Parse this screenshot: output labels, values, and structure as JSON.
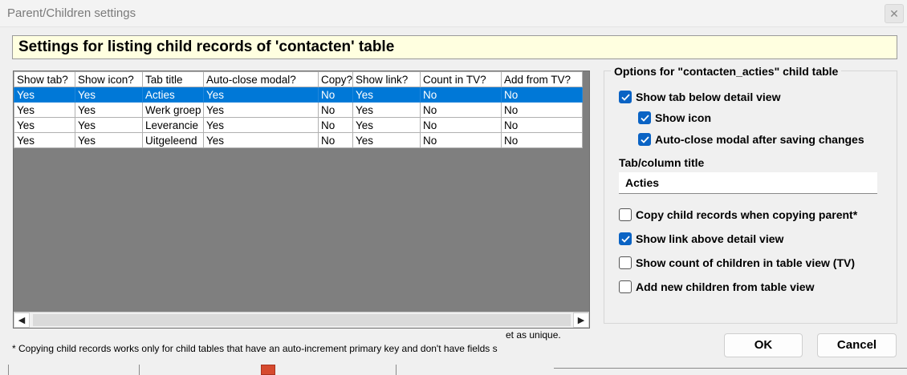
{
  "window": {
    "title": "Parent/Children settings"
  },
  "banner": {
    "text": "Settings for listing child records of 'contacten' table"
  },
  "grid": {
    "columns": [
      "Show tab?",
      "Show icon?",
      "Tab title",
      "Auto-close modal?",
      "Copy?",
      "Show link?",
      "Count in TV?",
      "Add from TV?"
    ],
    "rows": [
      [
        "Yes",
        "Yes",
        "Acties",
        "Yes",
        "No",
        "Yes",
        "No",
        "No"
      ],
      [
        "Yes",
        "Yes",
        "Werk groep",
        "Yes",
        "No",
        "Yes",
        "No",
        "No"
      ],
      [
        "Yes",
        "Yes",
        "Leverancie",
        "Yes",
        "No",
        "Yes",
        "No",
        "No"
      ],
      [
        "Yes",
        "Yes",
        "Uitgeleend",
        "Yes",
        "No",
        "Yes",
        "No",
        "No"
      ]
    ],
    "selected_row": 0
  },
  "footnote": {
    "text": "* Copying child records works only for child tables that have an auto-increment primary key and don't have fields s",
    "clipped_tail": "et as unique."
  },
  "options": {
    "legend": "Options for \"contacten_acties\" child table",
    "show_tab": {
      "label": "Show tab below detail view",
      "checked": true
    },
    "show_icon": {
      "label": "Show icon",
      "checked": true
    },
    "auto_close": {
      "label": "Auto-close modal after saving changes",
      "checked": true
    },
    "tab_title_label": "Tab/column title",
    "tab_title_value": "Acties",
    "copy_children": {
      "label": "Copy child records when copying parent*",
      "checked": false
    },
    "show_link": {
      "label": "Show link above detail view",
      "checked": true
    },
    "show_count": {
      "label": "Show count of children in table view (TV)",
      "checked": false
    },
    "add_from_tv": {
      "label": "Add new children from table view",
      "checked": false
    }
  },
  "buttons": {
    "ok": "OK",
    "cancel": "Cancel"
  },
  "icons": {
    "close": "close-icon",
    "checkmark": "checkmark-icon",
    "scroll_left": "chevron-left-icon",
    "scroll_right": "chevron-right-icon"
  },
  "colors": {
    "selection": "#0078d7",
    "banner_bg": "#ffffe0",
    "checkbox_checked": "#0a63c4"
  }
}
